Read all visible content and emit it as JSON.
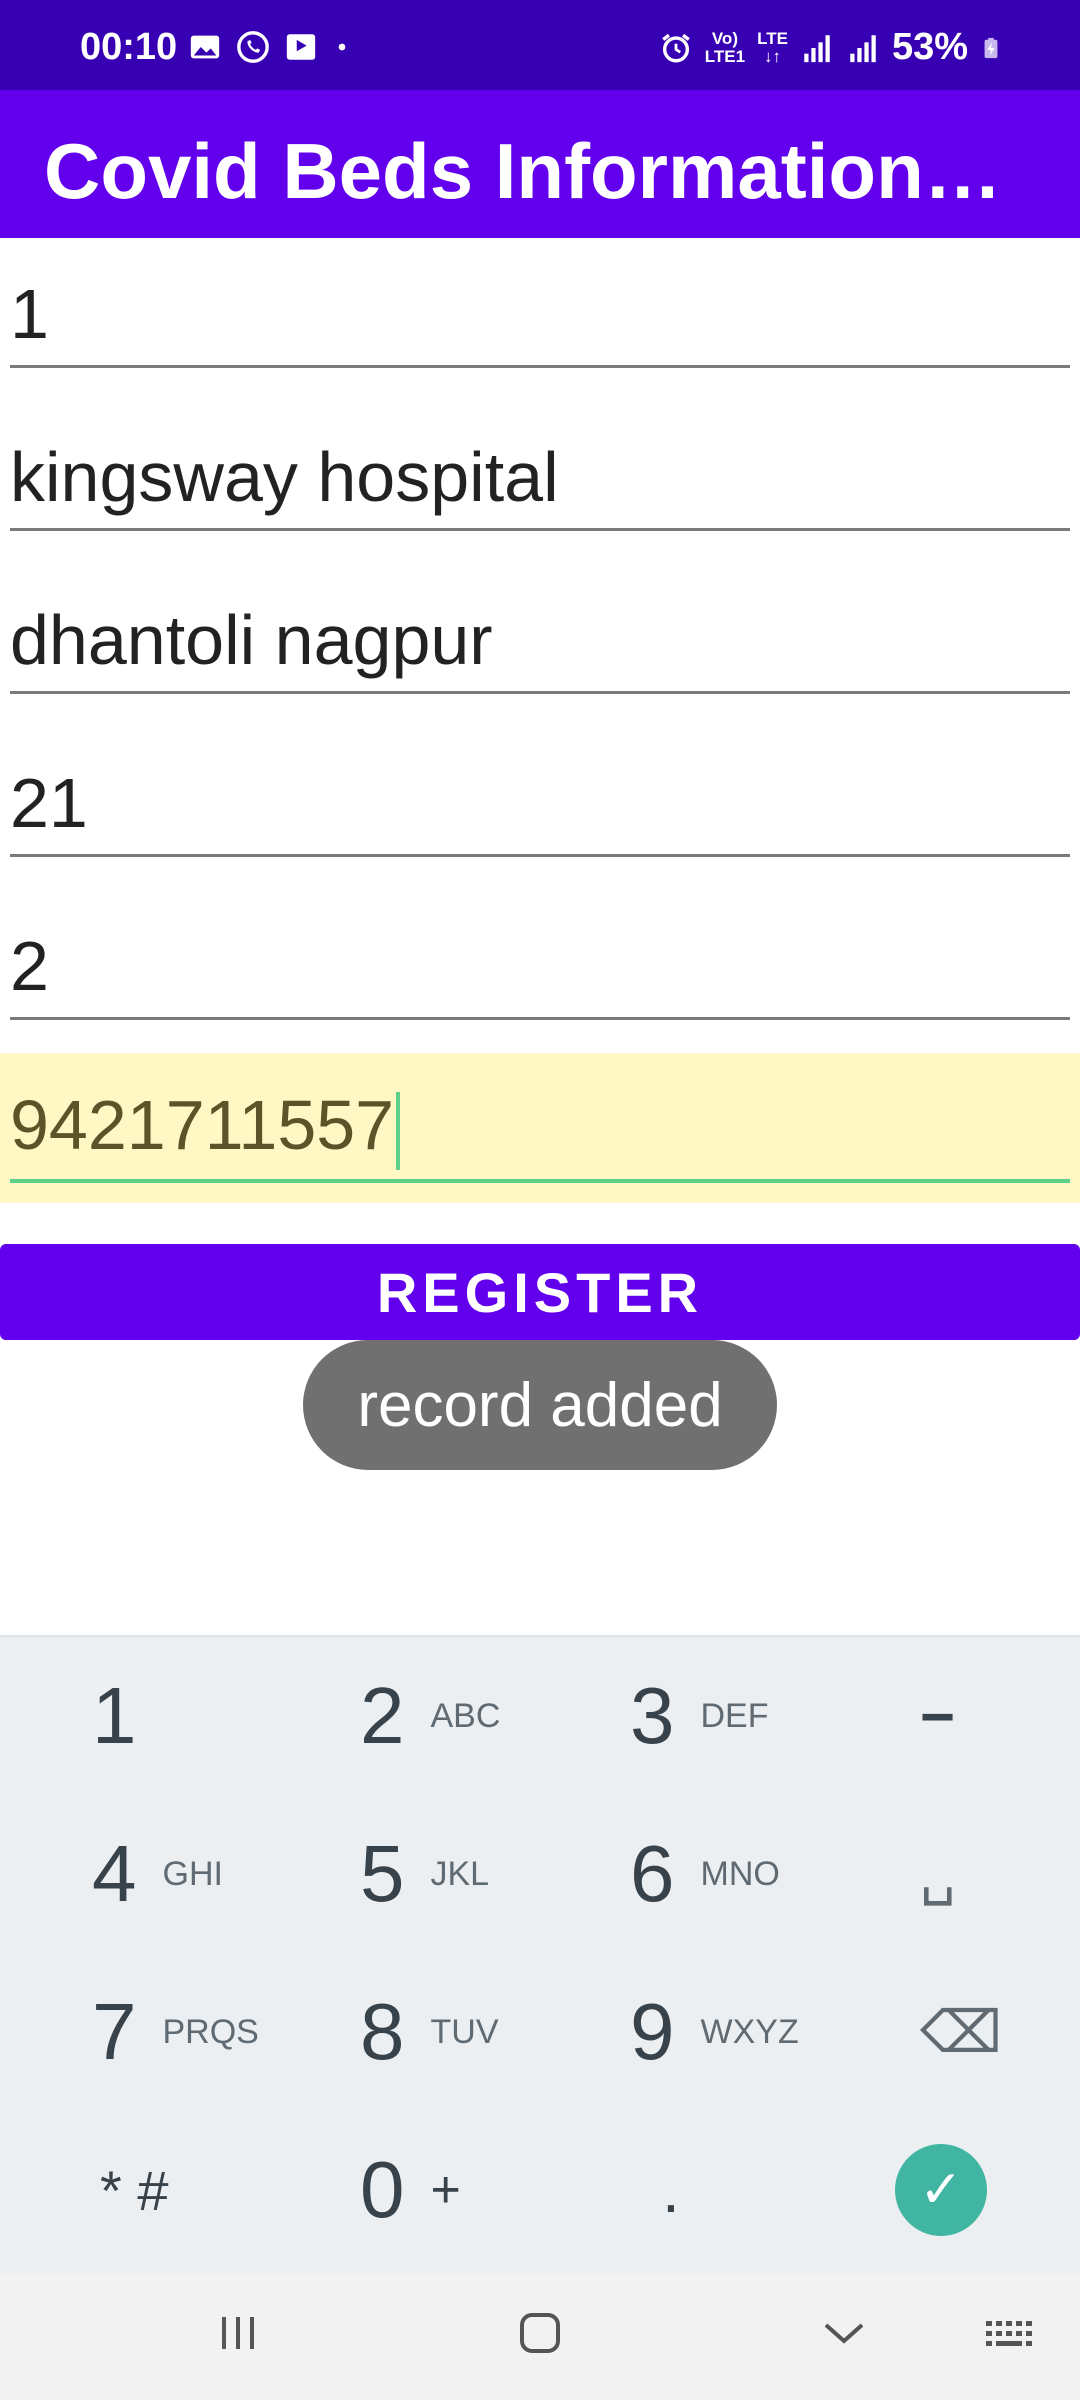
{
  "status_bar": {
    "time": "00:10",
    "battery": "53%",
    "network_text": "Vo) LTE LTE1",
    "icons": [
      "gallery-icon",
      "whatsapp-icon",
      "media-icon",
      "dot-icon",
      "alarm-icon",
      "volte-icon",
      "signal-icon",
      "signal-icon",
      "battery-charging-icon"
    ]
  },
  "app_bar": {
    "title": "Covid Beds Information…"
  },
  "form": {
    "fields": [
      {
        "value": "1"
      },
      {
        "value": "kingsway hospital"
      },
      {
        "value": "dhantoli nagpur"
      },
      {
        "value": "21"
      },
      {
        "value": "2"
      },
      {
        "value": "9421711557",
        "focused": true
      }
    ],
    "register_label": "REGISTER"
  },
  "toast": {
    "message": "record added"
  },
  "keyboard": {
    "keys": [
      {
        "num": "1",
        "letters": ""
      },
      {
        "num": "2",
        "letters": "ABC"
      },
      {
        "num": "3",
        "letters": "DEF"
      },
      {
        "num": "−",
        "letters": ""
      },
      {
        "num": "4",
        "letters": "GHI"
      },
      {
        "num": "5",
        "letters": "JKL"
      },
      {
        "num": "6",
        "letters": "MNO"
      },
      {
        "num": "␣",
        "letters": ""
      },
      {
        "num": "7",
        "letters": "PRQS"
      },
      {
        "num": "8",
        "letters": "TUV"
      },
      {
        "num": "9",
        "letters": "WXYZ"
      },
      {
        "num": "⌫",
        "letters": ""
      },
      {
        "num": "* #",
        "letters": ""
      },
      {
        "num": "0",
        "letters": "+"
      },
      {
        "num": ".",
        "letters": ""
      },
      {
        "num": "✓",
        "letters": ""
      }
    ]
  },
  "colors": {
    "status_bar": "#3700B3",
    "primary": "#6200EE",
    "focused_field_bg": "#FFF8C4",
    "accent_green": "#5fcf8c",
    "enter_teal": "#40B6A2",
    "toast_bg": "#707070"
  }
}
